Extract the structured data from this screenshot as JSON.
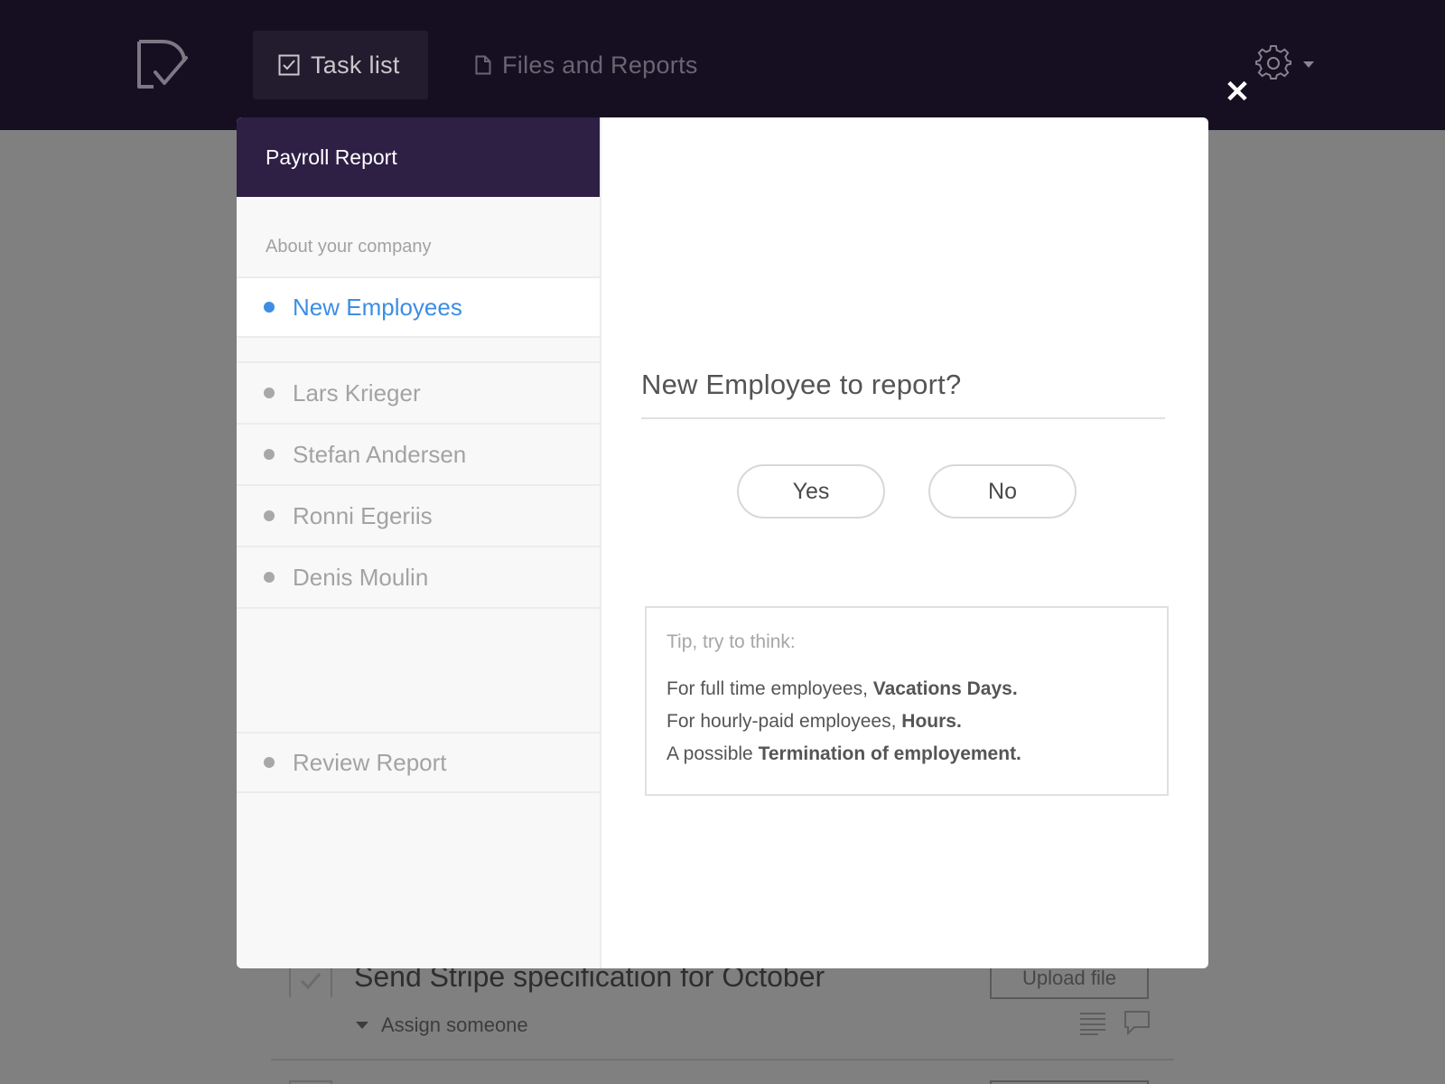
{
  "nav": {
    "tabs": [
      {
        "label": "Task list",
        "icon": "checkbox-icon",
        "active": true
      },
      {
        "label": "Files and Reports",
        "icon": "file-icon",
        "active": false
      }
    ]
  },
  "background": {
    "task_title": "Send Stripe specification for October",
    "upload_label": "Upload file",
    "assign_label": "Assign someone"
  },
  "modal": {
    "close_icon": "close-icon",
    "sidebar": {
      "title": "Payroll Report",
      "section_label": "About your company",
      "active_item": "New Employees",
      "employees": [
        "Lars Krieger",
        "Stefan Andersen",
        "Ronni Egeriis",
        "Denis Moulin"
      ],
      "review_item": "Review Report"
    },
    "main": {
      "question": "New Employee to report?",
      "yes_label": "Yes",
      "no_label": "No",
      "tip": {
        "title": "Tip, try to think:",
        "lines": [
          {
            "prefix": "For full time employees, ",
            "bold": "Vacations Days."
          },
          {
            "prefix": "For hourly-paid employees, ",
            "bold": "Hours."
          },
          {
            "prefix": "A possible ",
            "bold": "Termination of employement."
          }
        ]
      }
    }
  },
  "colors": {
    "topbar": "#160f22",
    "modal_header": "#2e1f45",
    "accent": "#3d8ee4",
    "overlay": "#808080"
  }
}
